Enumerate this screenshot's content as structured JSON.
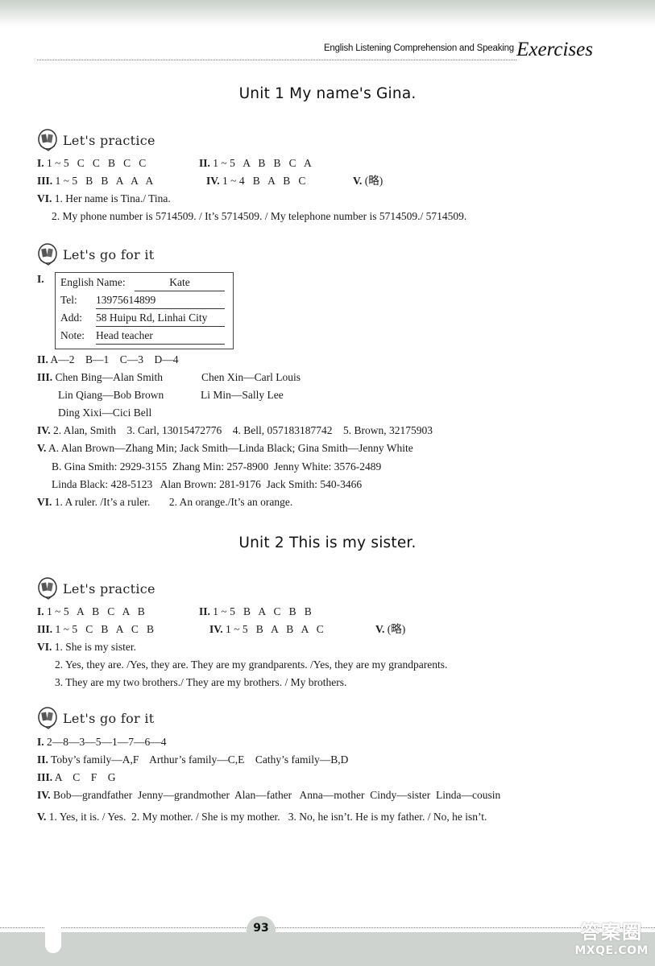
{
  "header": {
    "subtitle": "English Listening Comprehension and Speaking",
    "brand": "Exercises"
  },
  "units": [
    {
      "title": "Unit 1  My name's Gina.",
      "practice": {
        "label": "Let's practice",
        "lines": [
          {
            "num": "I.",
            "text": "1 ~ 5   C   C   B   C   C"
          },
          {
            "num": "II.",
            "text": "1 ~ 5   A   B   B   C   A"
          },
          {
            "num": "III.",
            "text": "1 ~ 5   B   B   A   A   A"
          },
          {
            "num": "IV.",
            "text": "1 ~ 4   B   A   B   C"
          },
          {
            "num": "V.",
            "text": "(略)"
          },
          {
            "num": "VI.",
            "text": "1. Her name is Tina./ Tina."
          },
          {
            "num": "",
            "text": "2. My phone number is 5714509. / It’s 5714509. / My telephone number is 5714509./ 5714509."
          }
        ]
      },
      "goforit": {
        "label": "Let's go for it",
        "card_num": "I.",
        "card": [
          {
            "label": "English Name:",
            "value": "Kate"
          },
          {
            "label": "Tel:",
            "value": "13975614899"
          },
          {
            "label": "Add:",
            "value": "58 Huipu Rd, Linhai City"
          },
          {
            "label": "Note:",
            "value": "Head teacher"
          }
        ],
        "lines": [
          {
            "num": "II.",
            "text": "A—2    B—1    C—3    D—4"
          },
          {
            "num": "III.",
            "text": "Chen Bing—Alan Smith"
          },
          {
            "num": "",
            "text": "Chen Xin—Carl Louis"
          },
          {
            "num": "",
            "text": "Lin Qiang—Bob Brown"
          },
          {
            "num": "",
            "text": "Li Min—Sally Lee"
          },
          {
            "num": "",
            "text": "Ding Xixi—Cici Bell"
          },
          {
            "num": "IV.",
            "text": "2. Alan, Smith    3. Carl, 13015472776    4. Bell, 057183187742    5. Brown, 32175903"
          },
          {
            "num": "V.",
            "text": "A. Alan Brown—Zhang Min; Jack Smith—Linda Black; Gina Smith—Jenny White"
          },
          {
            "num": "",
            "text": "B. Gina Smith: 2929-3155  Zhang Min: 257-8900  Jenny White: 3576-2489"
          },
          {
            "num": "",
            "text": "Linda Black: 428-5123   Alan Brown: 281-9176  Jack Smith: 540-3466"
          },
          {
            "num": "VI.",
            "text": "1. A ruler. /It’s a ruler.       2. An orange./It’s an orange."
          }
        ]
      }
    },
    {
      "title": "Unit 2  This is my sister.",
      "practice": {
        "label": "Let's practice",
        "lines": [
          {
            "num": "I.",
            "text": "1 ~ 5   A   B   C   A   B"
          },
          {
            "num": "II.",
            "text": "1 ~ 5   B   A   C   B   B"
          },
          {
            "num": "III.",
            "text": "1 ~ 5   C   B   A   C   B"
          },
          {
            "num": "IV.",
            "text": "1 ~ 5   B   A   B   A   C"
          },
          {
            "num": "V.",
            "text": "(略)"
          },
          {
            "num": "VI.",
            "text": "1. She is my sister."
          },
          {
            "num": "",
            "text": "2. Yes, they are. /Yes, they are. They are my grandparents. /Yes, they are my grandparents."
          },
          {
            "num": "",
            "text": "3. They are my two brothers./ They are my brothers. / My brothers."
          }
        ]
      },
      "goforit": {
        "label": "Let's go for it",
        "lines": [
          {
            "num": "I.",
            "text": "2—8—3—5—1—7—6—4"
          },
          {
            "num": "II.",
            "text": "Toby’s family—A,F    Arthur’s family—C,E    Cathy’s family—B,D"
          },
          {
            "num": "III.",
            "text": "A    C    F    G"
          },
          {
            "num": "IV.",
            "text": "Bob—grandfather  Jenny—grandmother  Alan—father   Anna—mother  Cindy—sister  Linda—cousin"
          },
          {
            "num": "V.",
            "text": "1. Yes, it is. / Yes.  2. My mother. / She is my mother.   3. No, he isn’t. He is my father. / No, he isn’t."
          }
        ]
      }
    }
  ],
  "footer": {
    "page_number": "93",
    "watermark_cn": "答案圈",
    "watermark_en": "MXQE.COM"
  }
}
